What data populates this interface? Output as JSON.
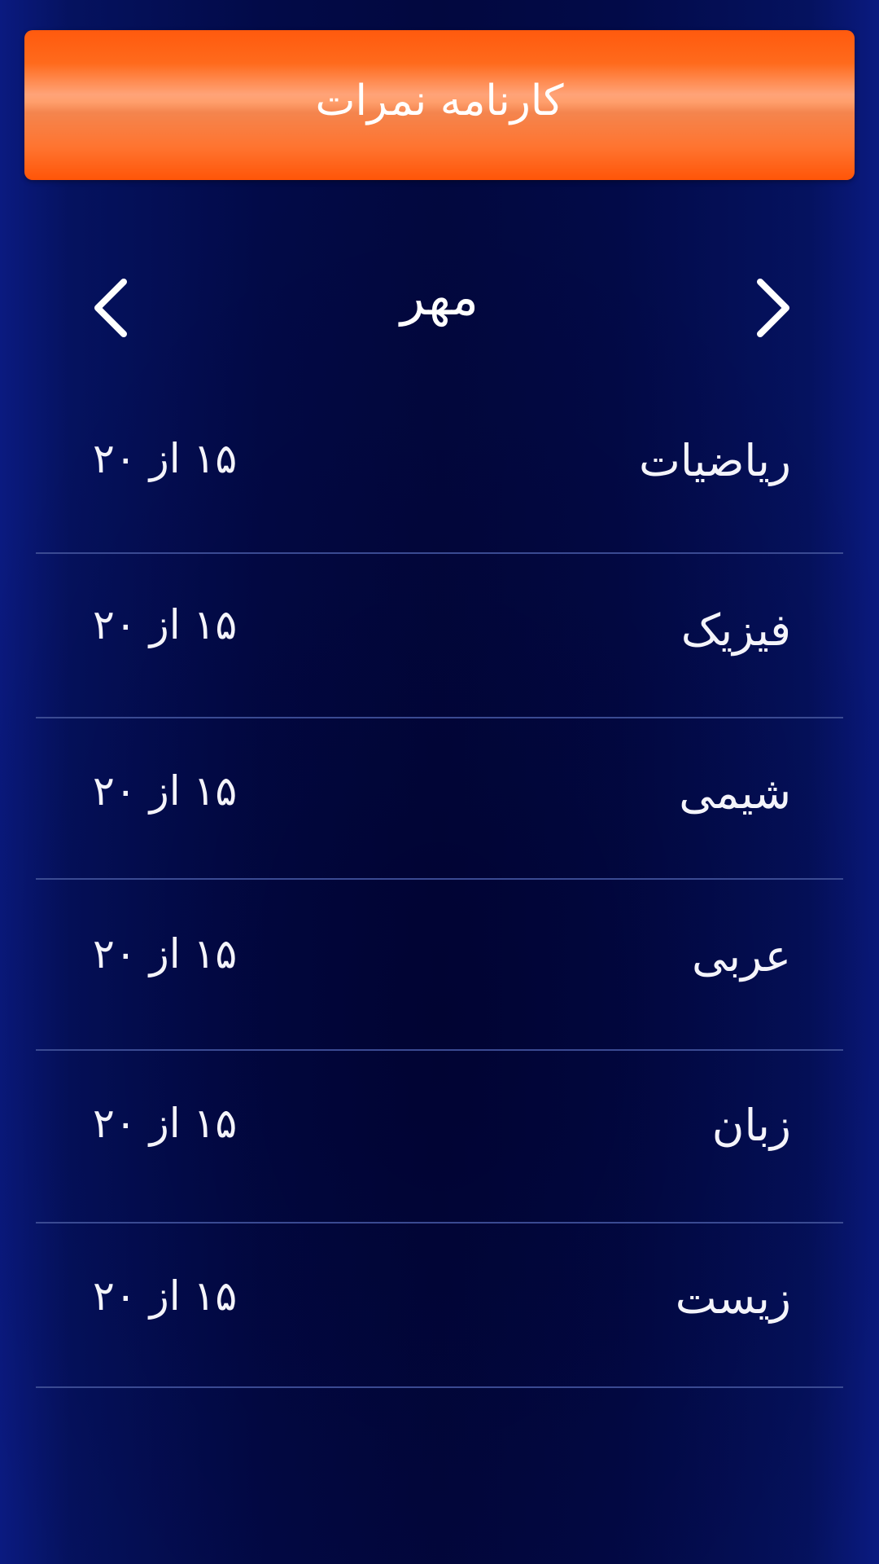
{
  "header": {
    "title": "کارنامه نمرات"
  },
  "month_nav": {
    "month": "مهر",
    "prev_icon": "chevron-left-icon",
    "next_icon": "chevron-right-icon"
  },
  "grades": [
    {
      "subject": "ریاضیات",
      "score": "۱۵ از ۲۰"
    },
    {
      "subject": "فیزیک",
      "score": "۱۵ از ۲۰"
    },
    {
      "subject": "شیمی",
      "score": "۱۵ از ۲۰"
    },
    {
      "subject": "عربی",
      "score": "۱۵ از ۲۰"
    },
    {
      "subject": "زبان",
      "score": "۱۵ از ۲۰"
    },
    {
      "subject": "زیست",
      "score": "۱۵ از ۲۰"
    }
  ],
  "colors": {
    "header_orange": "#ff5a0e",
    "background_navy": "#020a48",
    "divider": "#3a4a92"
  }
}
